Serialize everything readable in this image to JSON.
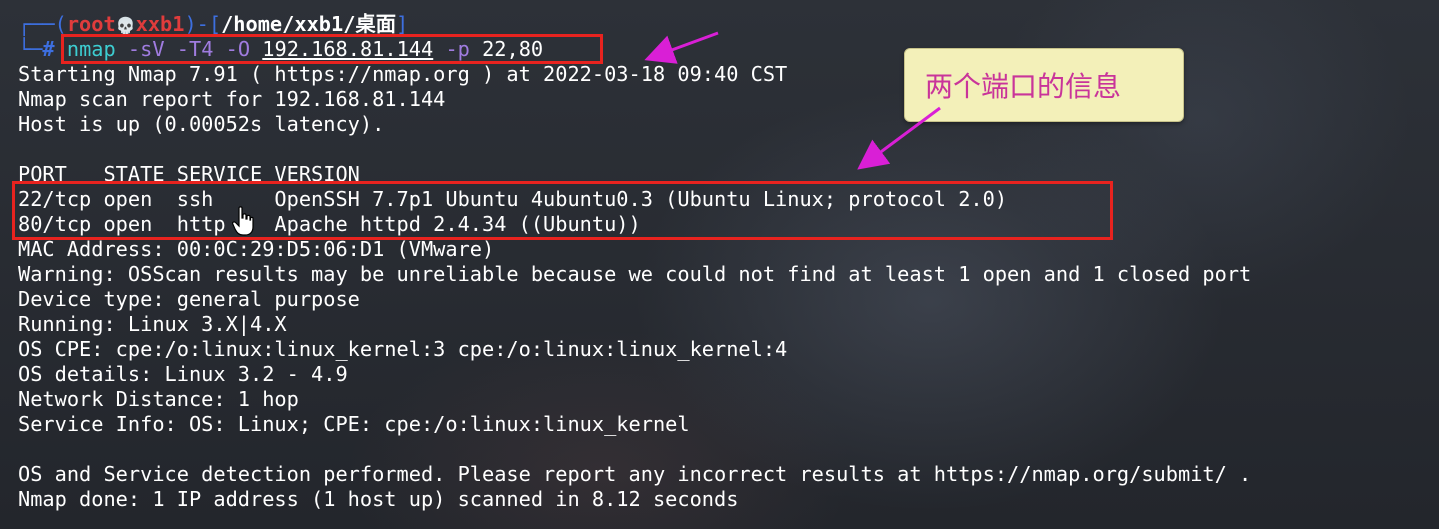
{
  "prompt": {
    "corner_top": "┌──(",
    "user": "root",
    "skull": "💀",
    "host": "xxb1",
    "mid": ")-[",
    "path": "/home/xxb1/桌面",
    "close": "]",
    "corner_bottom": "└─",
    "hash": "#"
  },
  "command": {
    "program": "nmap",
    "flag_sv": "-sV",
    "flag_t4": "-T4",
    "flag_o": "-O",
    "target": "192.168.81.144",
    "flag_p": "-p",
    "ports": "22,80"
  },
  "output": {
    "start": "Starting Nmap 7.91 ( https://nmap.org ) at 2022-03-18 09:40 CST",
    "report": "Nmap scan report for 192.168.81.144",
    "host_up": "Host is up (0.00052s latency).",
    "header": "PORT   STATE SERVICE VERSION",
    "row_22": "22/tcp open  ssh     OpenSSH 7.7p1 Ubuntu 4ubuntu0.3 (Ubuntu Linux; protocol 2.0)",
    "row_80": "80/tcp open  http    Apache httpd 2.4.34 ((Ubuntu))",
    "mac": "MAC Address: 00:0C:29:D5:06:D1 (VMware)",
    "warning": "Warning: OSScan results may be unreliable because we could not find at least 1 open and 1 closed port",
    "device": "Device type: general purpose",
    "running": "Running: Linux 3.X|4.X",
    "cpe": "OS CPE: cpe:/o:linux:linux_kernel:3 cpe:/o:linux:linux_kernel:4",
    "details": "OS details: Linux 3.2 - 4.9",
    "distance": "Network Distance: 1 hop",
    "service_info": "Service Info: OS: Linux; CPE: cpe:/o:linux:linux_kernel",
    "detection": "OS and Service detection performed. Please report any incorrect results at https://nmap.org/submit/ .",
    "done": "Nmap done: 1 IP address (1 host up) scanned in 8.12 seconds"
  },
  "annotation": {
    "callout_text": "两个端口的信息",
    "box_color": "#e8231f",
    "arrow_color": "#d91fd6",
    "callout_bg": "#f3f0b9"
  }
}
